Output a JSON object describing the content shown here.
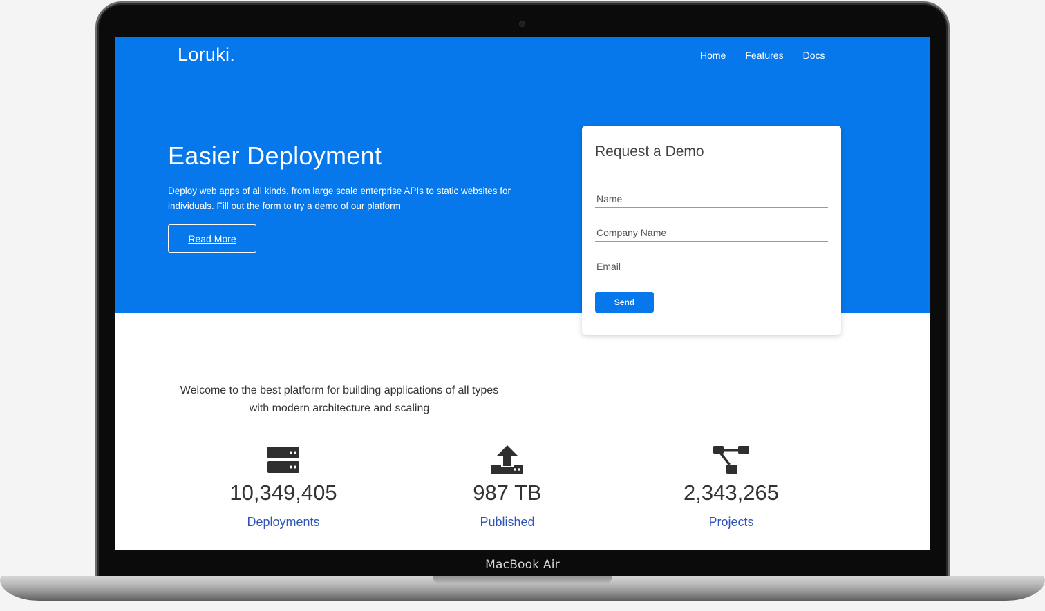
{
  "device": {
    "label": "MacBook Air"
  },
  "header": {
    "brand": "Loruki.",
    "nav": [
      "Home",
      "Features",
      "Docs"
    ]
  },
  "hero": {
    "title": "Easier Deployment",
    "description": "Deploy web apps of all kinds, from large scale enterprise APIs to static websites for individuals. Fill out the form to try a demo of our platform",
    "button_label": "Read More"
  },
  "demo_form": {
    "title": "Request a Demo",
    "name_placeholder": "Name",
    "company_placeholder": "Company Name",
    "email_placeholder": "Email",
    "send_label": "Send"
  },
  "welcome": "Welcome to the best platform for building applications of all types with modern architecture and scaling",
  "stats": [
    {
      "icon": "server-icon",
      "value": "10,349,405",
      "label": "Deployments"
    },
    {
      "icon": "upload-icon",
      "value": "987 TB",
      "label": "Published"
    },
    {
      "icon": "project-diagram-icon",
      "value": "2,343,265",
      "label": "Projects"
    }
  ],
  "colors": {
    "primary": "#0678ec",
    "stat_label": "#2f55b8"
  }
}
